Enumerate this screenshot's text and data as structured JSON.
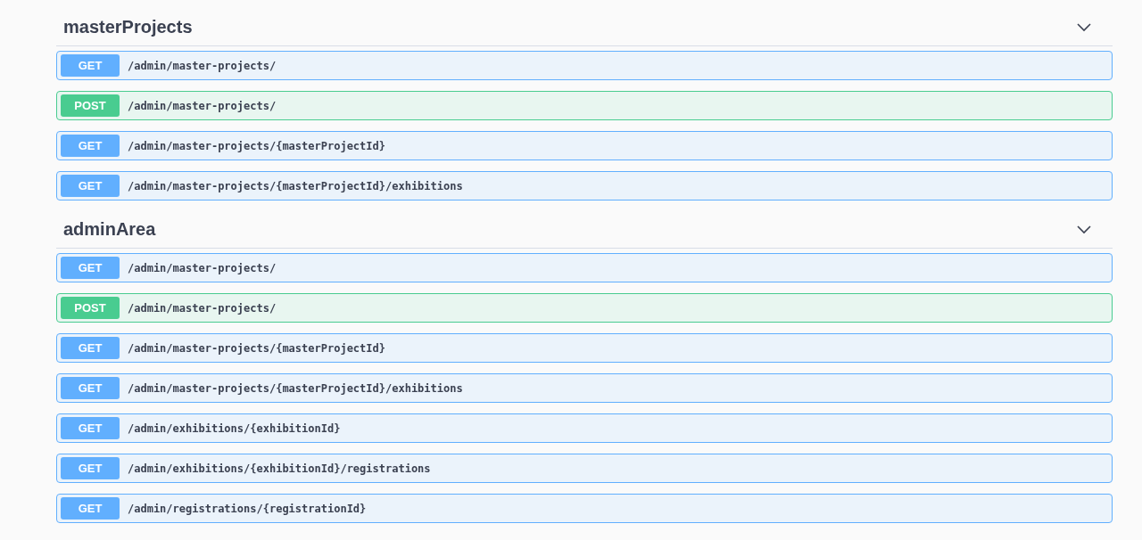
{
  "sections": [
    {
      "title": "masterProjects",
      "expanded": true,
      "operations": [
        {
          "kind": "get",
          "method": "GET",
          "path": "/admin/master-projects/"
        },
        {
          "kind": "post",
          "method": "POST",
          "path": "/admin/master-projects/"
        },
        {
          "kind": "get",
          "method": "GET",
          "path": "/admin/master-projects/{masterProjectId}"
        },
        {
          "kind": "get",
          "method": "GET",
          "path": "/admin/master-projects/{masterProjectId}/exhibitions"
        }
      ]
    },
    {
      "title": "adminArea",
      "expanded": true,
      "operations": [
        {
          "kind": "get",
          "method": "GET",
          "path": "/admin/master-projects/"
        },
        {
          "kind": "post",
          "method": "POST",
          "path": "/admin/master-projects/"
        },
        {
          "kind": "get",
          "method": "GET",
          "path": "/admin/master-projects/{masterProjectId}"
        },
        {
          "kind": "get",
          "method": "GET",
          "path": "/admin/master-projects/{masterProjectId}/exhibitions"
        },
        {
          "kind": "get",
          "method": "GET",
          "path": "/admin/exhibitions/{exhibitionId}"
        },
        {
          "kind": "get",
          "method": "GET",
          "path": "/admin/exhibitions/{exhibitionId}/registrations"
        },
        {
          "kind": "get",
          "method": "GET",
          "path": "/admin/registrations/{registrationId}"
        }
      ]
    }
  ]
}
